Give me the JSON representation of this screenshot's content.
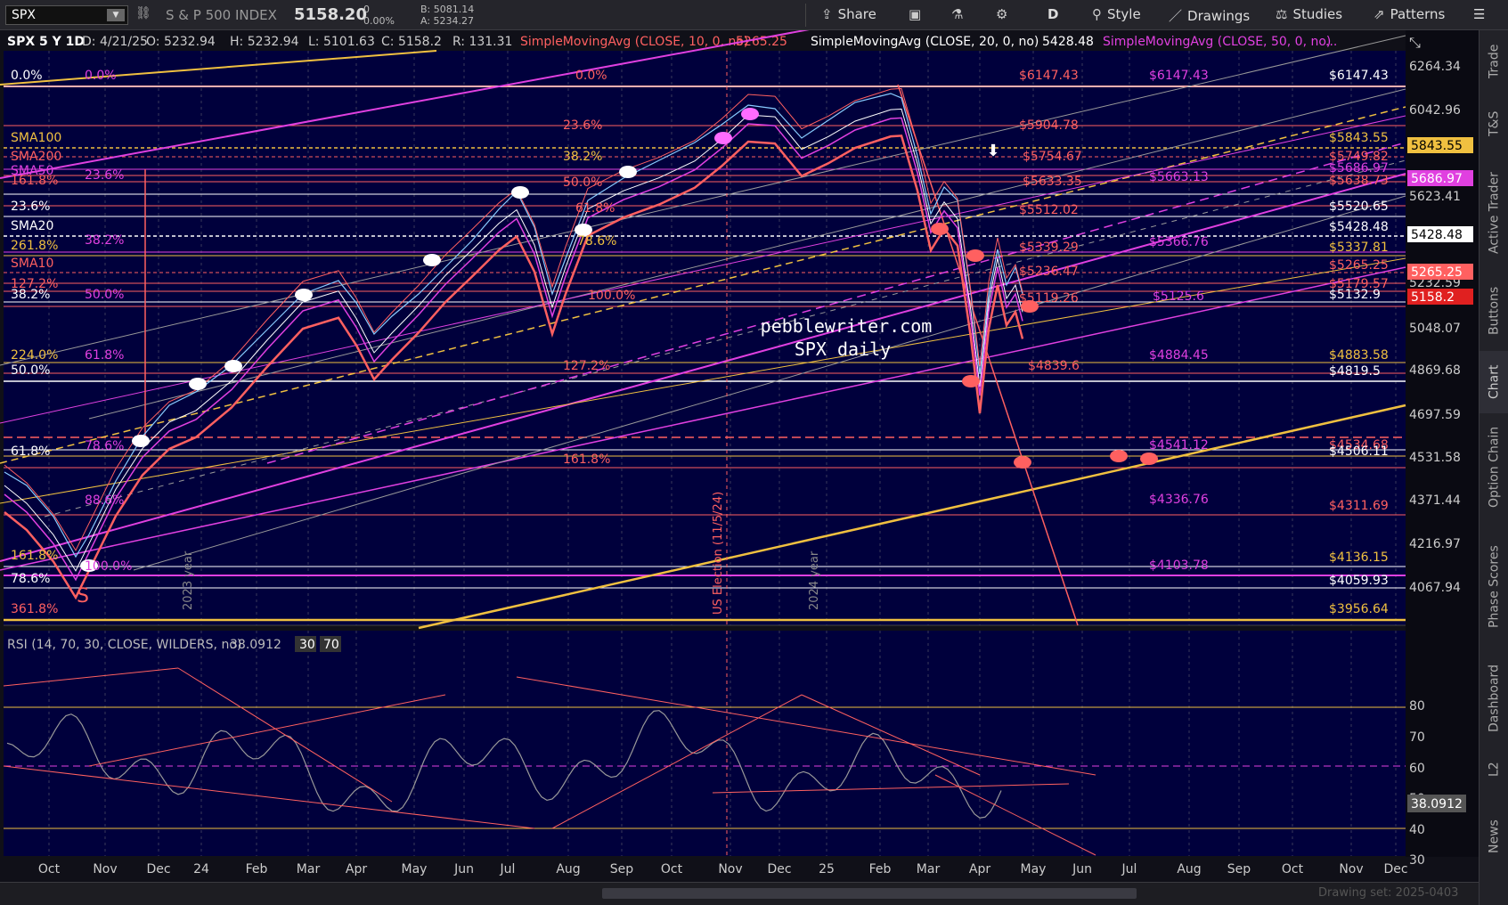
{
  "topbar": {
    "symbol": "SPX",
    "index_name": "S & P 500 INDEX",
    "last": "5158.20",
    "chg": "0",
    "chg_pct": "0.00%",
    "bid": "B: 5081.14",
    "ask": "A: 5234.27",
    "buttons": {
      "share": "Share",
      "d": "D",
      "style": "Style",
      "drawings": "Drawings",
      "studies": "Studies",
      "patterns": "Patterns"
    }
  },
  "header": {
    "chart_label": "SPX 5 Y 1D",
    "date": "D: 4/21/25",
    "open": "O: 5232.94",
    "high": "H: 5232.94",
    "low": "L: 5101.63",
    "close": "C: 5158.2",
    "range": "R: 131.31",
    "sma10": "SimpleMovingAvg (CLOSE, 10, 0, no)",
    "sma10_val": "5265.25",
    "sma20": "SimpleMovingAvg (CLOSE, 20, 0, no)",
    "sma20_val": "5428.48",
    "sma50": "SimpleMovingAvg (CLOSE, 50, 0, no)",
    "ellipsis": "..."
  },
  "watermark": {
    "line1": "pebblewriter.com",
    "line2": "SPX daily"
  },
  "vertical_labels": {
    "y2023": "2023 year",
    "y2024": "2024 year",
    "election": "US Election (11/5/24)"
  },
  "s_marker": "S",
  "price_axis": {
    "ticks": [
      "6264.34",
      "6042.96",
      "5623.41",
      "5048.07",
      "4869.68",
      "4697.59",
      "4531.58",
      "4371.44",
      "4216.97",
      "4067.94"
    ],
    "tags": [
      {
        "text": "5843.55",
        "bg": "#f0c040",
        "fg": "#000"
      },
      {
        "text": "5686.97",
        "bg": "#e040e0",
        "fg": "#fff"
      },
      {
        "text": "5428.48",
        "bg": "#ffffff",
        "fg": "#000"
      },
      {
        "text": "5265.25",
        "bg": "#ff6060",
        "fg": "#fff"
      },
      {
        "text": "5158.2",
        "bg": "#e02020",
        "fg": "#fff"
      }
    ],
    "partial": "5232.59"
  },
  "time_axis": [
    "Oct",
    "Nov",
    "Dec",
    "24",
    "Feb",
    "Mar",
    "Apr",
    "May",
    "Jun",
    "Jul",
    "Aug",
    "Sep",
    "Oct",
    "Nov",
    "Dec",
    "25",
    "Feb",
    "Mar",
    "Apr",
    "May",
    "Jun",
    "Jul",
    "Aug",
    "Sep",
    "Oct",
    "Nov",
    "Dec"
  ],
  "left_labels": [
    {
      "t": "0.0%",
      "c": "#ffffff"
    },
    {
      "t": "0.0%",
      "c": "#e040e0"
    },
    {
      "t": "SMA100",
      "c": "#f0c040"
    },
    {
      "t": "SMA200",
      "c": "#ff6060"
    },
    {
      "t": "SMA50",
      "c": "#e040e0"
    },
    {
      "t": "161.8%",
      "c": "#ff6060"
    },
    {
      "t": "23.6%",
      "c": "#e040e0"
    },
    {
      "t": "23.6%",
      "c": "#ffffff"
    },
    {
      "t": "SMA20",
      "c": "#ffffff"
    },
    {
      "t": "38.2%",
      "c": "#e040e0"
    },
    {
      "t": "261.8%",
      "c": "#f0c040"
    },
    {
      "t": "SMA10",
      "c": "#ff6060"
    },
    {
      "t": "127.2%",
      "c": "#ff6060"
    },
    {
      "t": "38.2%",
      "c": "#ffffff"
    },
    {
      "t": "50.0%",
      "c": "#e040e0"
    },
    {
      "t": "224.0%",
      "c": "#f0c040"
    },
    {
      "t": "61.8%",
      "c": "#e040e0"
    },
    {
      "t": "50.0%",
      "c": "#ffffff"
    },
    {
      "t": "78.6%",
      "c": "#e040e0"
    },
    {
      "t": "61.8%",
      "c": "#ffffff"
    },
    {
      "t": "88.6%",
      "c": "#e040e0"
    },
    {
      "t": "161.8%",
      "c": "#f0c040"
    },
    {
      "t": "100.0%",
      "c": "#e040e0"
    },
    {
      "t": "78.6%",
      "c": "#ffffff"
    },
    {
      "t": "361.8%",
      "c": "#ff6060"
    }
  ],
  "mid_labels": [
    {
      "t": "0.0%",
      "c": "#ff6060"
    },
    {
      "t": "23.6%",
      "c": "#ff6060"
    },
    {
      "t": "38.2%",
      "c": "#f0c040"
    },
    {
      "t": "50.0%",
      "c": "#ff6060"
    },
    {
      "t": "61.8%",
      "c": "#ff6060"
    },
    {
      "t": "78.6%",
      "c": "#f0c040"
    },
    {
      "t": "100.0%",
      "c": "#ff6060"
    },
    {
      "t": "127.2%",
      "c": "#ff6060"
    },
    {
      "t": "161.8%",
      "c": "#ff6060"
    }
  ],
  "level_labels": [
    {
      "t": "$6147.43",
      "c": "#ff6060"
    },
    {
      "t": "$6147.43",
      "c": "#e040e0"
    },
    {
      "t": "$6147.43",
      "c": "#ffffff"
    },
    {
      "t": "$5904.78",
      "c": "#ff6060"
    },
    {
      "t": "$5843.55",
      "c": "#f0c040"
    },
    {
      "t": "$5754.67",
      "c": "#ff6060"
    },
    {
      "t": "$5749.82",
      "c": "#ff6060"
    },
    {
      "t": "$5686.97",
      "c": "#e040e0"
    },
    {
      "t": "$5663.13",
      "c": "#e040e0"
    },
    {
      "t": "$5638.73",
      "c": "#ff6060"
    },
    {
      "t": "$5633.35",
      "c": "#ff6060"
    },
    {
      "t": "$5512.02",
      "c": "#ff6060"
    },
    {
      "t": "$5520.65",
      "c": "#ffffff"
    },
    {
      "t": "$5428.48",
      "c": "#ffffff"
    },
    {
      "t": "$5366.76",
      "c": "#e040e0"
    },
    {
      "t": "$5339.29",
      "c": "#ff6060"
    },
    {
      "t": "$5337.81",
      "c": "#f0c040"
    },
    {
      "t": "$5265.25",
      "c": "#ff6060"
    },
    {
      "t": "$5236.47",
      "c": "#ff6060"
    },
    {
      "t": "$5179.57",
      "c": "#ff6060"
    },
    {
      "t": "$5132.9",
      "c": "#ffffff"
    },
    {
      "t": "$5125.6",
      "c": "#e040e0"
    },
    {
      "t": "$5119.26",
      "c": "#ff6060"
    },
    {
      "t": "$4884.45",
      "c": "#e040e0"
    },
    {
      "t": "$4883.58",
      "c": "#f0c040"
    },
    {
      "t": "$4839.6",
      "c": "#ff6060"
    },
    {
      "t": "$4819.5",
      "c": "#ffffff"
    },
    {
      "t": "$4541.12",
      "c": "#e040e0"
    },
    {
      "t": "$4534.68",
      "c": "#ff6060"
    },
    {
      "t": "$4506.11",
      "c": "#ffffff"
    },
    {
      "t": "$4336.76",
      "c": "#e040e0"
    },
    {
      "t": "$4311.69",
      "c": "#ff6060"
    },
    {
      "t": "$4136.15",
      "c": "#f0c040"
    },
    {
      "t": "$4103.78",
      "c": "#e040e0"
    },
    {
      "t": "$4059.93",
      "c": "#ffffff"
    },
    {
      "t": "$3956.64",
      "c": "#f0c040"
    }
  ],
  "rsi": {
    "label": "RSI (14, 70, 30, CLOSE, WILDERS, no)",
    "value": "38.0912",
    "lo": "30",
    "hi": "70",
    "ticks": [
      "80",
      "70",
      "60",
      "50",
      "40",
      "30"
    ]
  },
  "right_tabs": [
    "Trade",
    "T&S",
    "Active Trader",
    "Buttons",
    "Chart",
    "Option Chain",
    "Phase Scores",
    "Dashboard",
    "L2",
    "News"
  ],
  "bottom": {
    "drawing_set": "Drawing set: 2025-0403"
  },
  "colors": {
    "bg": "#101018",
    "white": "#ffffff",
    "magenta": "#e040e0",
    "yellow": "#f0c040",
    "red": "#ff6060"
  }
}
